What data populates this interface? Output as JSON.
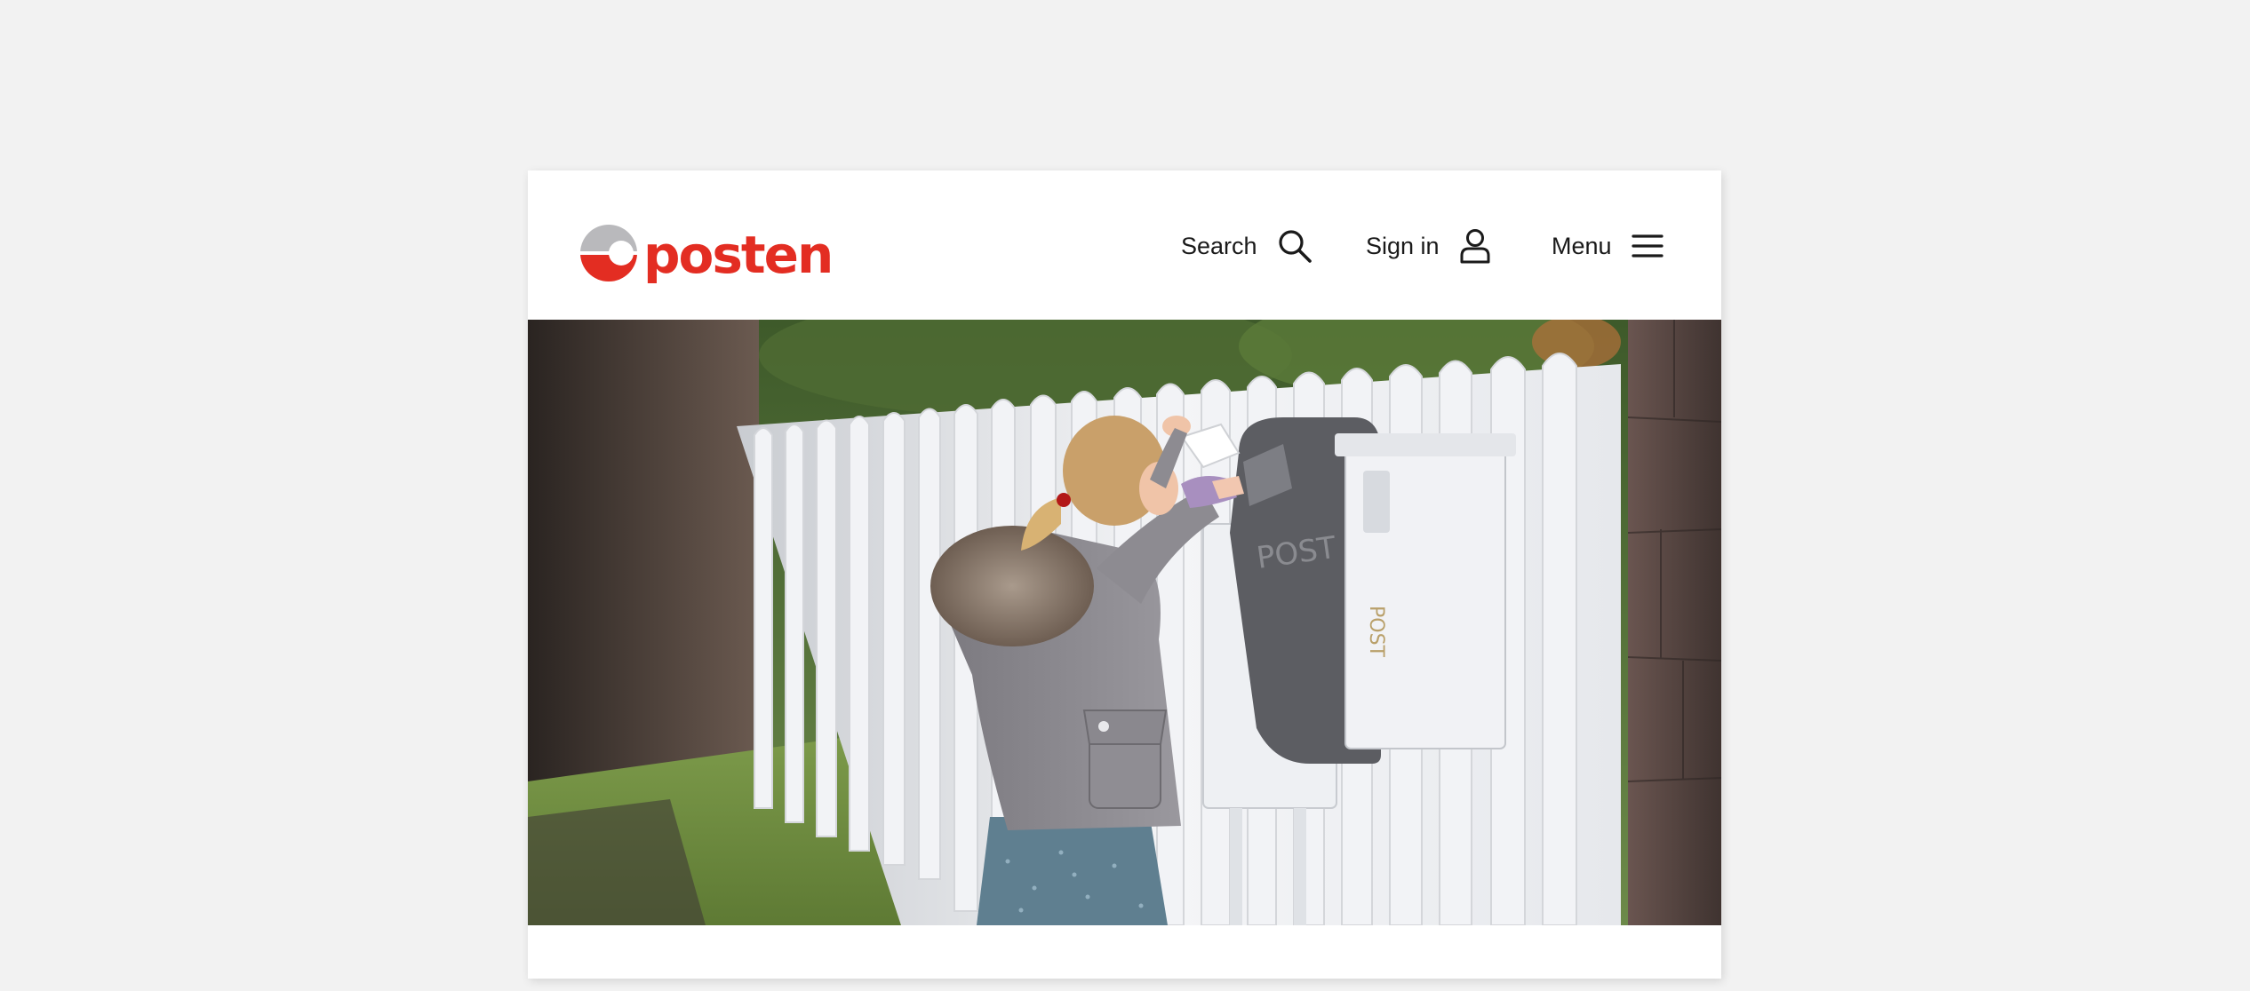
{
  "header": {
    "logo": {
      "text": "posten",
      "brand_color": "#e32d22",
      "icon": "posten-logo-icon"
    },
    "nav": {
      "search": {
        "label": "Search",
        "icon": "search-icon"
      },
      "sign_in": {
        "label": "Sign in",
        "icon": "user-icon"
      },
      "menu": {
        "label": "Menu",
        "icon": "hamburger-menu-icon"
      }
    }
  },
  "hero": {
    "description_icon": "hero-photo-girl-mailbox"
  },
  "colors": {
    "background": "#f2f2f2",
    "card": "#ffffff",
    "accent": "#e32d22"
  }
}
